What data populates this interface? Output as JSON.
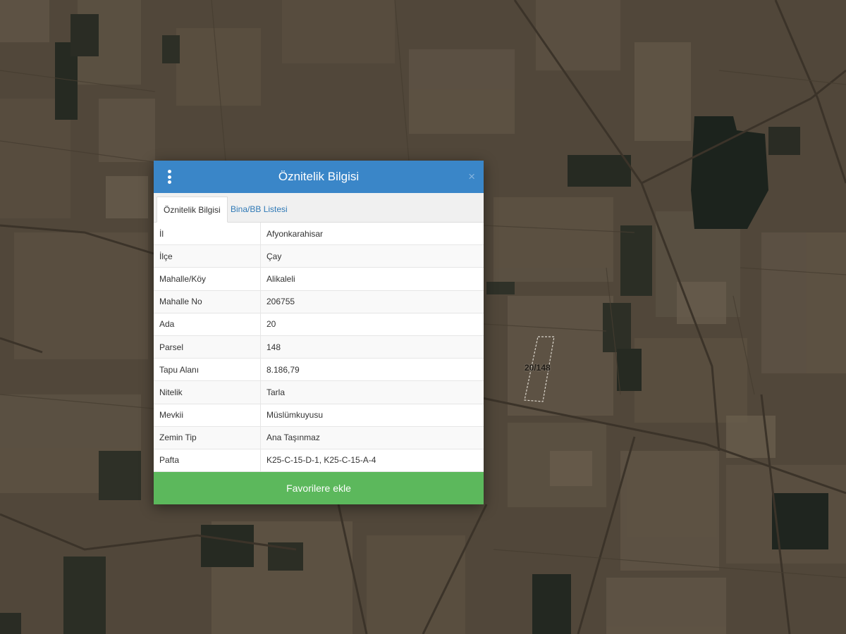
{
  "dialog": {
    "title": "Öznitelik Bilgisi",
    "close_glyph": "×",
    "header_color": "#3a86c8",
    "tabs": [
      {
        "label": "Öznitelik Bilgisi",
        "active": true
      },
      {
        "label": "Bina/BB Listesi",
        "active": false
      }
    ],
    "rows": [
      {
        "key": "İl",
        "value": "Afyonkarahisar"
      },
      {
        "key": "İlçe",
        "value": "Çay"
      },
      {
        "key": "Mahalle/Köy",
        "value": "Alikaleli"
      },
      {
        "key": "Mahalle No",
        "value": "206755"
      },
      {
        "key": "Ada",
        "value": "20"
      },
      {
        "key": "Parsel",
        "value": "148"
      },
      {
        "key": "Tapu Alanı",
        "value": "8.186,79"
      },
      {
        "key": "Nitelik",
        "value": "Tarla"
      },
      {
        "key": "Mevkii",
        "value": "Müslümkuyusu"
      },
      {
        "key": "Zemin Tip",
        "value": "Ana Taşınmaz"
      },
      {
        "key": "Pafta",
        "value": "K25-C-15-D-1, K25-C-15-A-4"
      }
    ],
    "favorite_button": "Favorilere ekle",
    "favorite_color": "#5cb85c",
    "icons": {
      "menu": "vertical-dots-icon",
      "close": "close-icon"
    }
  },
  "map": {
    "parcel_label": "20/148"
  }
}
